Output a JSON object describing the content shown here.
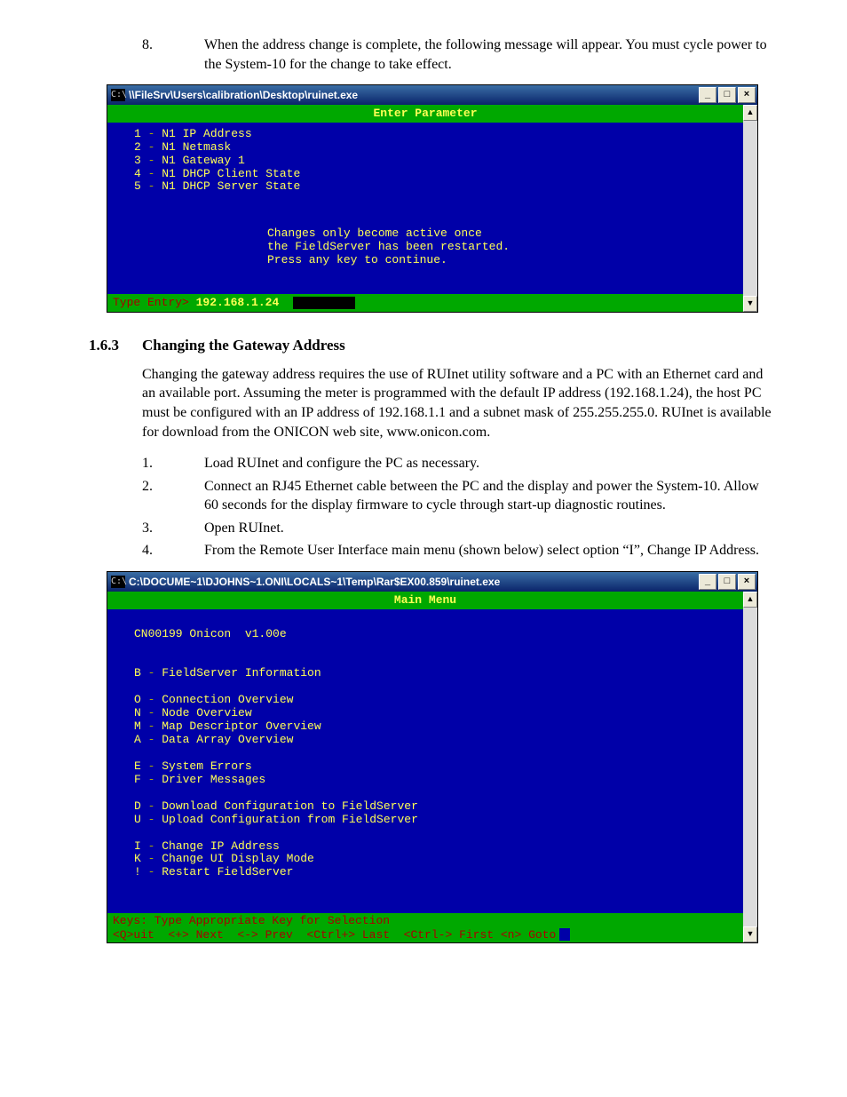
{
  "step8": {
    "num": "8.",
    "text": "When the address change is complete, the following message will appear. You must cycle power to the System-10 for the change to take effect."
  },
  "console1": {
    "icon": "C:\\",
    "title": "\\\\FileSrv\\Users\\calibration\\Desktop\\ruinet.exe",
    "header": "Enter Parameter",
    "opts": [
      {
        "k": "1",
        "d": " - ",
        "t": "N1 IP Address"
      },
      {
        "k": "2",
        "d": " - ",
        "t": "N1 Netmask"
      },
      {
        "k": "3",
        "d": " - ",
        "t": "N1 Gateway 1"
      },
      {
        "k": "4",
        "d": " - ",
        "t": "N1 DHCP Client State"
      },
      {
        "k": "5",
        "d": " - ",
        "t": "N1 DHCP Server State"
      }
    ],
    "msg": "Changes only become active once\nthe FieldServer has been restarted.\nPress any key to continue.",
    "entry_label": "Type Entry> ",
    "entry_value": "192.168.1.24"
  },
  "section": {
    "num": "1.6.3",
    "title": "Changing the Gateway Address",
    "para": "Changing the gateway address requires the use of RUInet utility software and a PC with an Ethernet card and an available port. Assuming the meter is programmed with the default IP address (192.168.1.24), the host PC must be configured with an IP address of 192.168.1.1 and a subnet mask of 255.255.255.0. RUInet is available for download from the ONICON web site, www.onicon.com.",
    "steps": [
      {
        "n": "1.",
        "t": "Load RUInet and configure the PC as necessary."
      },
      {
        "n": "2.",
        "t": "Connect an RJ45 Ethernet cable between the PC and the display and power the System-10. Allow 60 seconds for the display firmware to cycle through start-up diagnostic routines."
      },
      {
        "n": "3.",
        "t": "Open RUInet."
      },
      {
        "n": "4.",
        "t": "From the Remote User Interface main menu (shown below) select option “I”, Change IP Address."
      }
    ]
  },
  "console2": {
    "icon": "C:\\",
    "title": "C:\\DOCUME~1\\DJOHNS~1.ONI\\LOCALS~1\\Temp\\Rar$EX00.859\\ruinet.exe",
    "header": "Main Menu",
    "version": "CN00199 Onicon  v1.00e",
    "groups": [
      [
        {
          "k": "B",
          "t": "FieldServer Information"
        }
      ],
      [
        {
          "k": "O",
          "t": "Connection Overview"
        },
        {
          "k": "N",
          "t": "Node Overview"
        },
        {
          "k": "M",
          "t": "Map Descriptor Overview"
        },
        {
          "k": "A",
          "t": "Data Array Overview"
        }
      ],
      [
        {
          "k": "E",
          "t": "System Errors"
        },
        {
          "k": "F",
          "t": "Driver Messages"
        }
      ],
      [
        {
          "k": "D",
          "t": "Download Configuration to FieldServer"
        },
        {
          "k": "U",
          "t": "Upload Configuration from FieldServer"
        }
      ],
      [
        {
          "k": "I",
          "t": "Change IP Address"
        },
        {
          "k": "K",
          "t": "Change UI Display Mode"
        },
        {
          "k": "!",
          "t": "Restart FieldServer"
        }
      ]
    ],
    "footer1": "Keys: Type Appropriate Key for Selection",
    "footer2": "<Q>uit  <+> Next  <-> Prev  <Ctrl+> Last  <Ctrl-> First <n> Goto"
  },
  "winbtns": {
    "min": "_",
    "max": "□",
    "close": "×"
  },
  "scroll": {
    "up": "▲",
    "down": "▼"
  }
}
